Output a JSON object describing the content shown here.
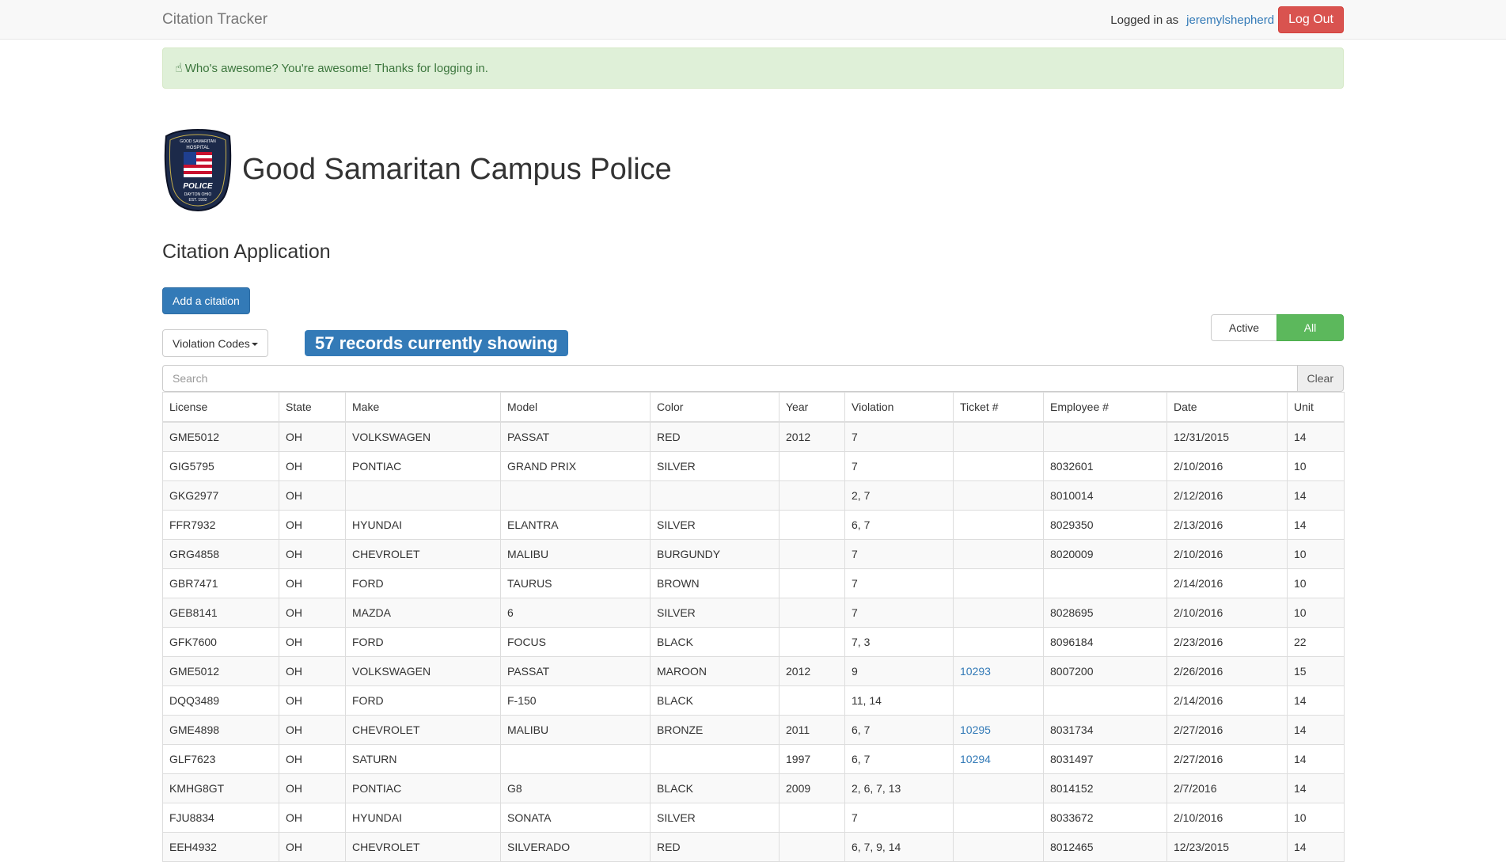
{
  "navbar": {
    "brand": "Citation Tracker",
    "logged_in_text": "Logged in as",
    "username": "jeremylshepherd",
    "logout_label": "Log Out"
  },
  "alert": {
    "message": "Who's awesome? You're awesome! Thanks for logging in.",
    "icon": "hand-icon"
  },
  "header": {
    "title": "Good Samaritan Campus Police",
    "subtitle": "Citation Application",
    "badge_text": {
      "top": "GOOD SAMARITAN",
      "hospital": "HOSPITAL",
      "police": "POLICE",
      "city": "DAYTON OHIO",
      "est": "EST. 1932"
    }
  },
  "controls": {
    "add_label": "Add a citation",
    "violation_codes_label": "Violation Codes",
    "records_text": "57 records currently showing",
    "active_label": "Active",
    "all_label": "All",
    "search_placeholder": "Search",
    "clear_label": "Clear"
  },
  "table": {
    "columns": [
      "License",
      "State",
      "Make",
      "Model",
      "Color",
      "Year",
      "Violation",
      "Ticket #",
      "Employee #",
      "Date",
      "Unit"
    ],
    "rows": [
      [
        "GME5012",
        "OH",
        "VOLKSWAGEN",
        "PASSAT",
        "RED",
        "2012",
        "7",
        "",
        "",
        "12/31/2015",
        "14"
      ],
      [
        "GIG5795",
        "OH",
        "PONTIAC",
        "GRAND PRIX",
        "SILVER",
        "",
        "7",
        "",
        "8032601",
        "2/10/2016",
        "10"
      ],
      [
        "GKG2977",
        "OH",
        "",
        "",
        "",
        "",
        "2, 7",
        "",
        "8010014",
        "2/12/2016",
        "14"
      ],
      [
        "FFR7932",
        "OH",
        "HYUNDAI",
        "ELANTRA",
        "SILVER",
        "",
        "6, 7",
        "",
        "8029350",
        "2/13/2016",
        "14"
      ],
      [
        "GRG4858",
        "OH",
        "CHEVROLET",
        "MALIBU",
        "BURGUNDY",
        "",
        "7",
        "",
        "8020009",
        "2/10/2016",
        "10"
      ],
      [
        "GBR7471",
        "OH",
        "FORD",
        "TAURUS",
        "BROWN",
        "",
        "7",
        "",
        "",
        "2/14/2016",
        "10"
      ],
      [
        "GEB8141",
        "OH",
        "MAZDA",
        "6",
        "SILVER",
        "",
        "7",
        "",
        "8028695",
        "2/10/2016",
        "10"
      ],
      [
        "GFK7600",
        "OH",
        "FORD",
        "FOCUS",
        "BLACK",
        "",
        "7, 3",
        "",
        "8096184",
        "2/23/2016",
        "22"
      ],
      [
        "GME5012",
        "OH",
        "VOLKSWAGEN",
        "PASSAT",
        "MAROON",
        "2012",
        "9",
        "10293",
        "8007200",
        "2/26/2016",
        "15"
      ],
      [
        "DQQ3489",
        "OH",
        "FORD",
        "F-150",
        "BLACK",
        "",
        "11, 14",
        "",
        "",
        "2/14/2016",
        "14"
      ],
      [
        "GME4898",
        "OH",
        "CHEVROLET",
        "MALIBU",
        "BRONZE",
        "2011",
        "6, 7",
        "10295",
        "8031734",
        "2/27/2016",
        "14"
      ],
      [
        "GLF7623",
        "OH",
        "SATURN",
        "",
        "",
        "1997",
        "6, 7",
        "10294",
        "8031497",
        "2/27/2016",
        "14"
      ],
      [
        "KMHG8GT",
        "OH",
        "PONTIAC",
        "G8",
        "BLACK",
        "2009",
        "2, 6, 7, 13",
        "",
        "8014152",
        "2/7/2016",
        "14"
      ],
      [
        "FJU8834",
        "OH",
        "HYUNDAI",
        "SONATA",
        "SILVER",
        "",
        "7",
        "",
        "8033672",
        "2/10/2016",
        "10"
      ],
      [
        "EEH4932",
        "OH",
        "CHEVROLET",
        "SILVERADO",
        "RED",
        "",
        "6, 7, 9, 14",
        "",
        "8012465",
        "12/23/2015",
        "14"
      ]
    ]
  },
  "colors": {
    "primary": "#337ab7",
    "danger": "#d9534f",
    "success": "#5cb85c",
    "alert_bg": "#dff0d8",
    "alert_text": "#3c763d"
  }
}
